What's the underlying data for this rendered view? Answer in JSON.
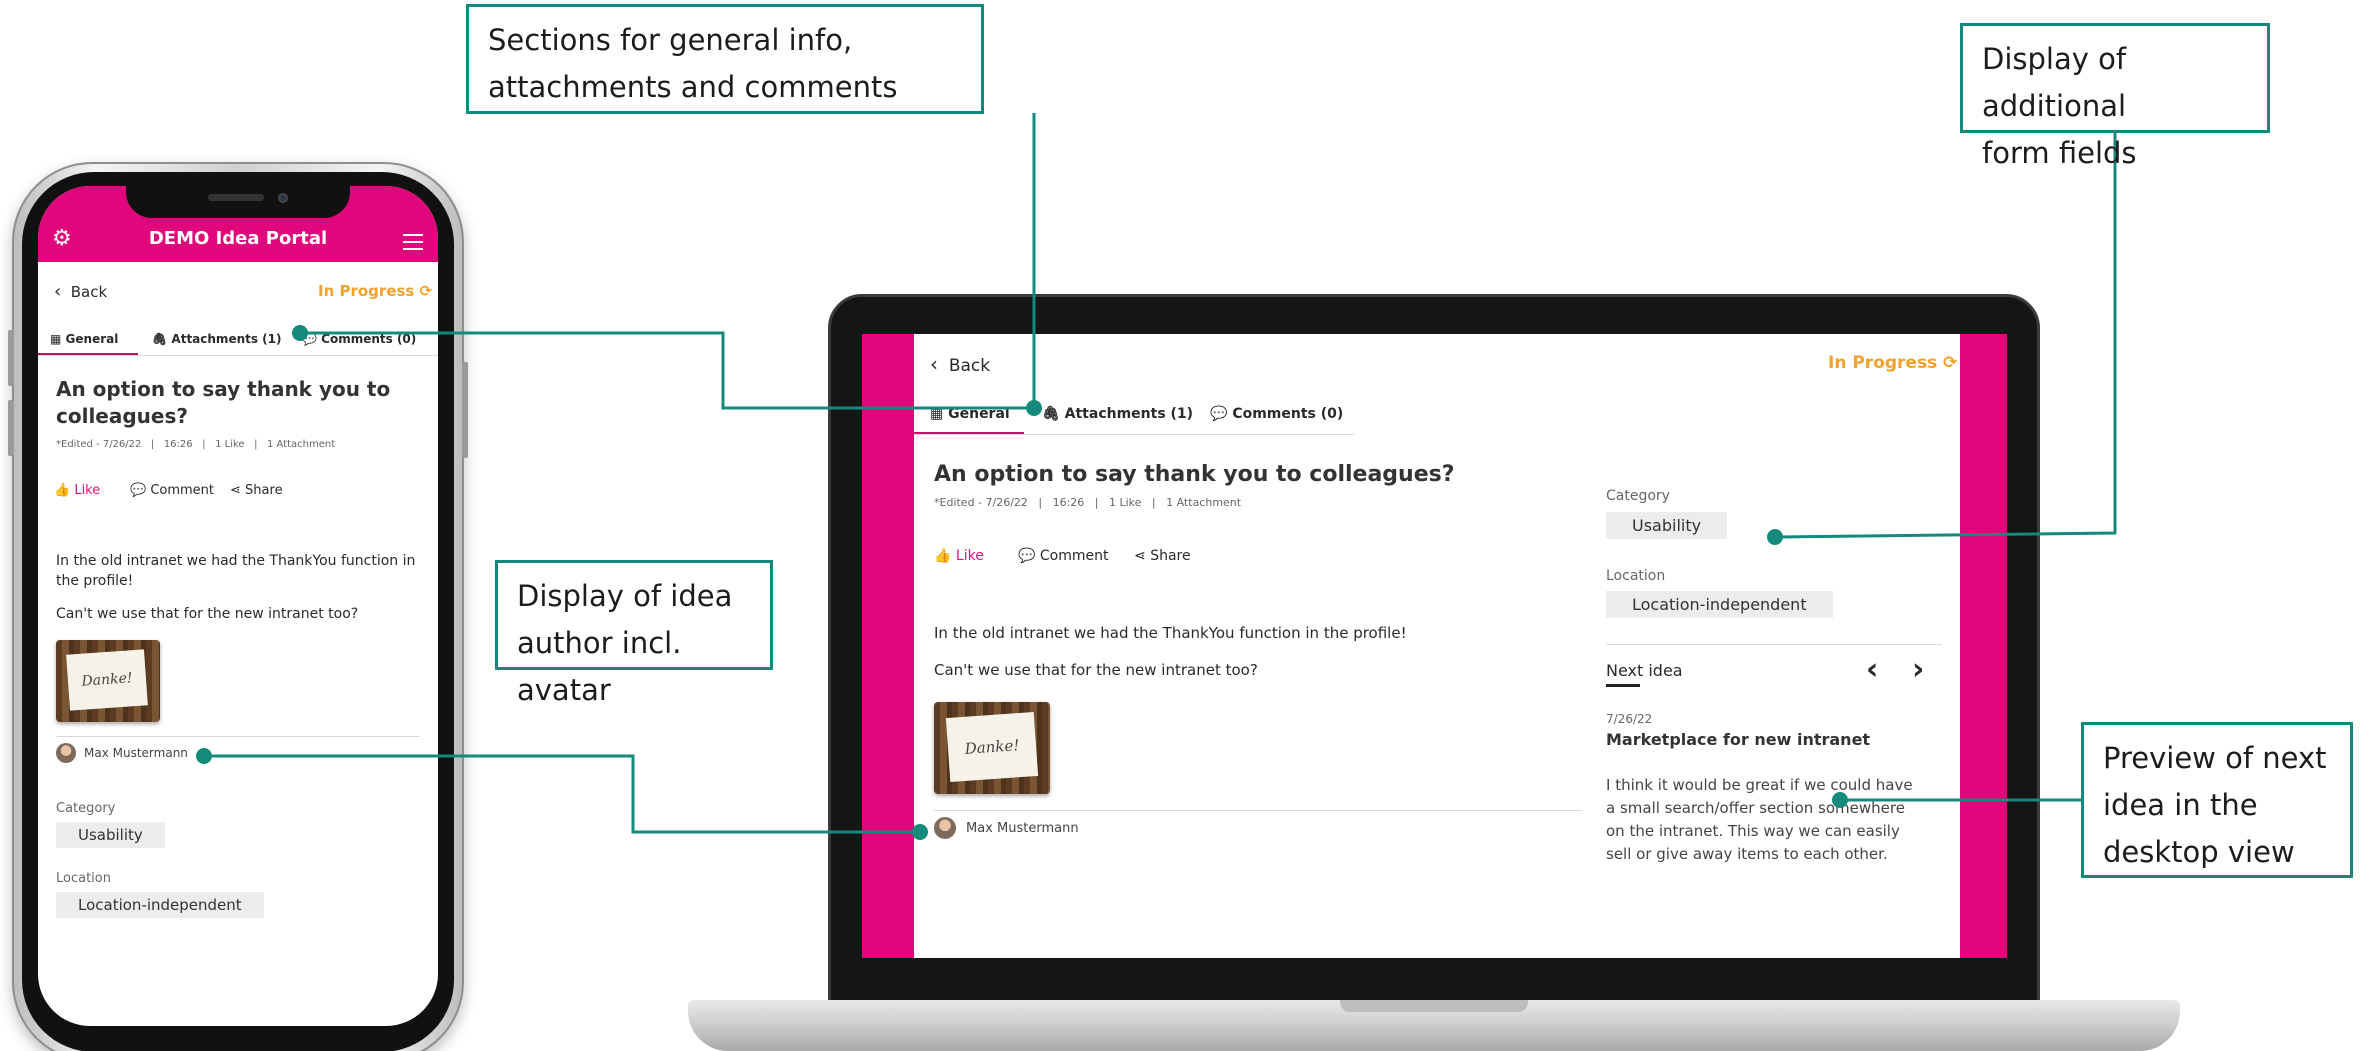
{
  "callouts": {
    "sections": [
      "Sections for general info,",
      "attachments and comments"
    ],
    "form_fields": [
      "Display of additional",
      "form fields"
    ],
    "author": [
      "Display of idea",
      "author incl. avatar"
    ],
    "preview": [
      "Preview of next",
      "idea in the",
      "desktop view"
    ]
  },
  "app": {
    "title": "DEMO Idea Portal",
    "back": "Back",
    "status": "In Progress",
    "tabs": [
      "General",
      "Attachments (1)",
      "Comments (0)"
    ],
    "idea_title": "An option to say thank you to colleagues?",
    "idea_title_lines": [
      "An option to say thank you to",
      "colleagues?"
    ],
    "meta": "*Edited - 7/26/22   |   16:26   |   1 Like   |   1 Attachment",
    "actions": {
      "like": "Like",
      "comment": "Comment",
      "share": "Share"
    },
    "body_line1": "In the old intranet we had the ThankYou function in the profile!",
    "body_line1_wrapped": [
      "In the old intranet we had the ThankYou function in",
      "the profile!"
    ],
    "body_line2": "Can't we use that for the new intranet too?",
    "image_text": "Danke!",
    "author": "Max Mustermann",
    "category_label": "Category",
    "category_value": "Usability",
    "location_label": "Location",
    "location_value": "Location-independent",
    "next_idea": {
      "label": "Next idea",
      "date": "7/26/22",
      "title": "Marketplace for new intranet",
      "text_lines": [
        "I think it would be great if we could have",
        "a small search/offer section somewhere",
        "on the intranet. This way we can easily",
        "sell or give away items to each other."
      ]
    }
  },
  "colors": {
    "brand_pink": "#e0077d",
    "status_orange": "#f2a22c",
    "callout_teal": "#138a7c"
  },
  "icons": [
    "gear-icon",
    "menu-icon",
    "back-chevron-icon",
    "refresh-icon",
    "grid-icon",
    "paperclip-icon",
    "comment-icon",
    "thumbs-up-icon",
    "share-icon",
    "prev-arrow-icon",
    "next-arrow-icon"
  ]
}
